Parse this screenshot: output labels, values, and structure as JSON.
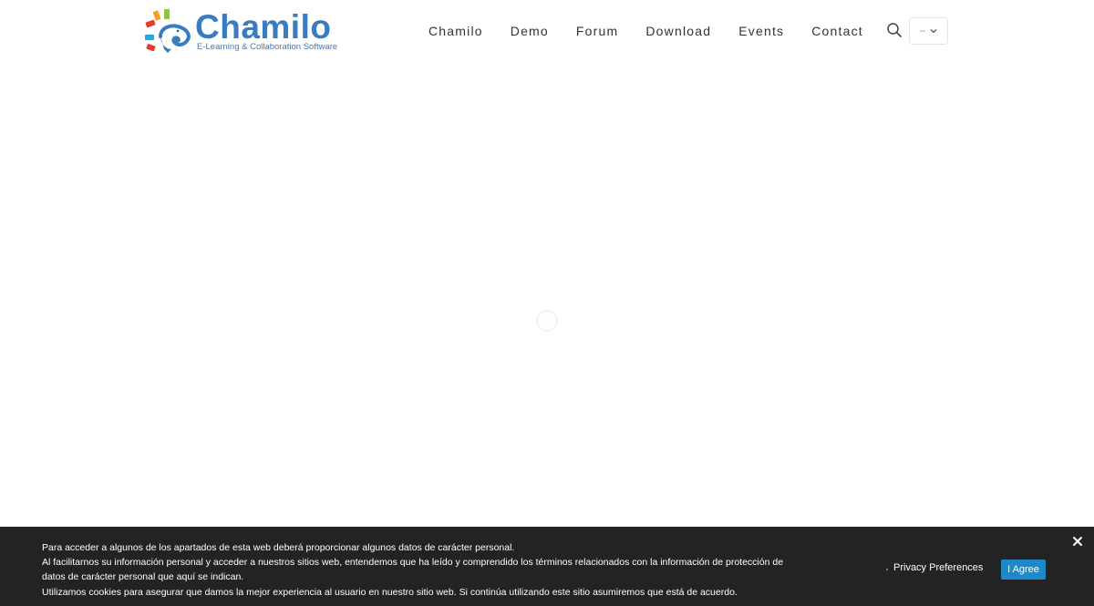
{
  "header": {
    "logo": {
      "wordmark": "Chamilo",
      "tagline": "E-Learning & Collaboration Software"
    },
    "nav": [
      {
        "label": "Chamilo"
      },
      {
        "label": "Demo"
      },
      {
        "label": "Forum"
      },
      {
        "label": "Download"
      },
      {
        "label": "Events"
      },
      {
        "label": "Contact"
      }
    ],
    "search_icon": "search-icon",
    "language_select": {
      "value": "–"
    }
  },
  "cookie_notice": {
    "lines": [
      "Para acceder a algunos de los apartados de esta web deberá proporcionar algunos datos de carácter personal.",
      "Al facilitarnos su información personal y acceder a nuestros sitios web, entendemos que ha leído y comprendido los términos relacionados con la información de protección de datos de carácter personal que aquí se indican.",
      "Utilizamos cookies para asegurar que damos la mejor experiencia al usuario en nuestro sitio web. Si continúa utilizando este sitio asumiremos que está de acuerdo."
    ],
    "privacy_label": "Privacy Preferences",
    "agree_label": "I Agree",
    "close_icon": "close-icon"
  },
  "colors": {
    "brand_blue": "#3a7cc0",
    "cookie_bg": "#232323",
    "agree_button": "#1e88c9"
  }
}
